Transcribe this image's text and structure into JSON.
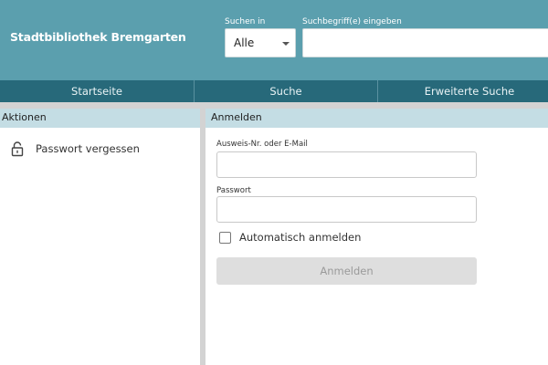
{
  "header": {
    "site_title": "Stadtbibliothek Bremgarten",
    "search_scope_label": "Suchen in",
    "search_scope_value": "Alle",
    "search_term_label": "Suchbegriff(e) eingeben",
    "search_term_value": ""
  },
  "nav": {
    "items": [
      {
        "label": "Startseite"
      },
      {
        "label": "Suche"
      },
      {
        "label": "Erweiterte Suche"
      }
    ]
  },
  "sidebar": {
    "heading": "Aktionen",
    "items": [
      {
        "label": "Passwort vergessen",
        "icon": "lock-icon"
      }
    ]
  },
  "login": {
    "heading": "Anmelden",
    "user_label": "Ausweis-Nr. oder E-Mail",
    "user_value": "",
    "password_label": "Passwort",
    "password_value": "",
    "auto_login_label": "Automatisch anmelden",
    "auto_login_checked": false,
    "submit_label": "Anmelden"
  },
  "colors": {
    "header_bg": "#5b9fae",
    "nav_bg": "#27697a",
    "panel_heading_bg": "#c4dde4",
    "button_disabled_bg": "#dedede"
  }
}
